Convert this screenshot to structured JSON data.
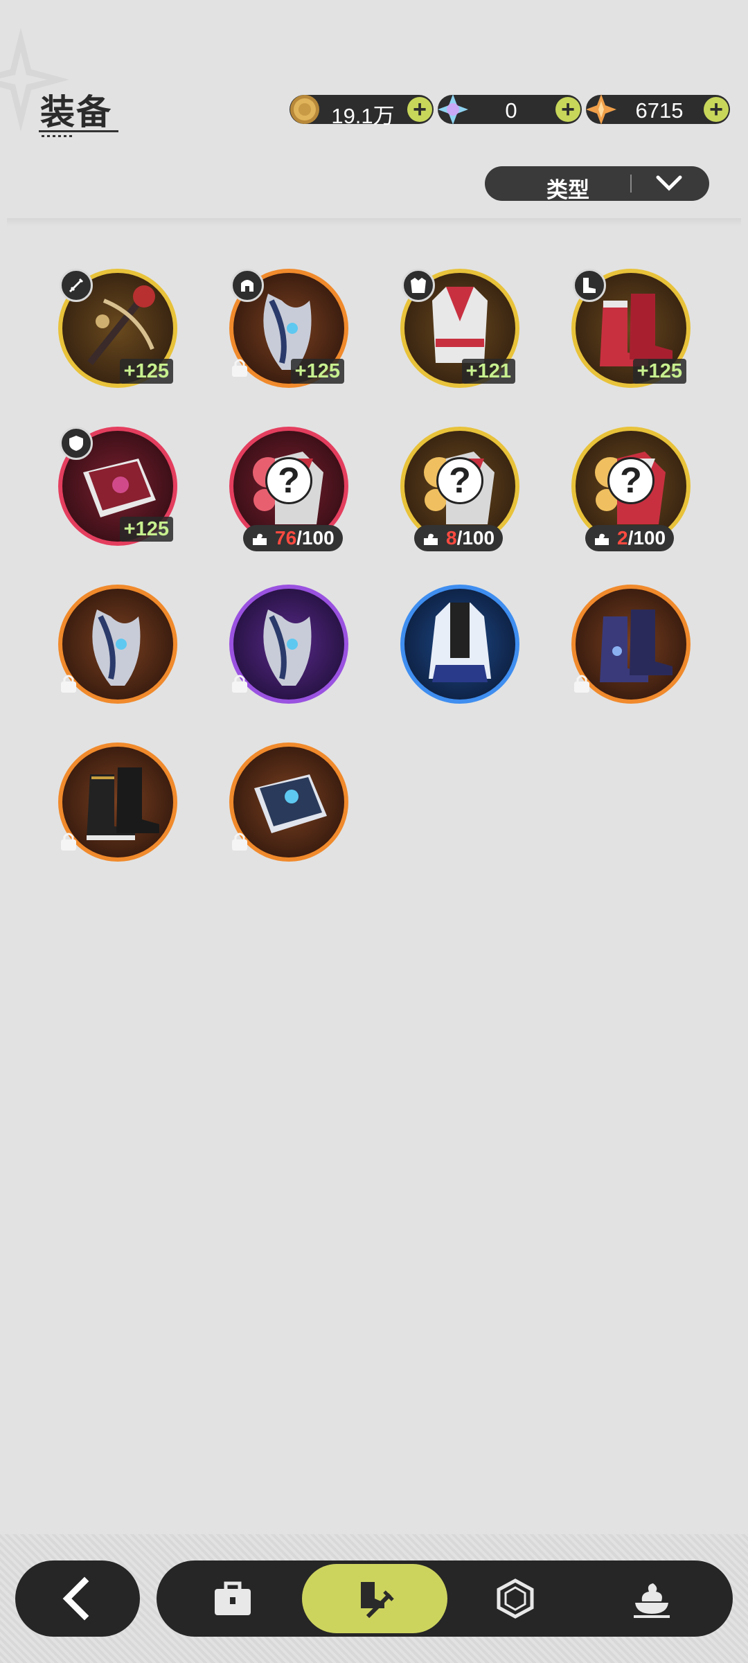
{
  "header": {
    "title": "装备"
  },
  "currencies": [
    {
      "name": "gold-coin",
      "value": "19.1万"
    },
    {
      "name": "crystal",
      "value": "0"
    },
    {
      "name": "star-gem",
      "value": "6715"
    }
  ],
  "filter": {
    "label": "类型"
  },
  "equipment": [
    {
      "name": "weapon",
      "slot": "sword",
      "rarity": "gold",
      "level": "+125"
    },
    {
      "name": "helmet",
      "slot": "helmet",
      "rarity": "orange",
      "level": "+125",
      "locked": true
    },
    {
      "name": "armor",
      "slot": "armor",
      "rarity": "gold",
      "level": "+121"
    },
    {
      "name": "boots",
      "slot": "boots",
      "rarity": "gold",
      "level": "+125"
    },
    {
      "name": "book",
      "slot": "shield",
      "rarity": "red",
      "level": "+125"
    },
    {
      "name": "unknown-armor-red",
      "rarity": "red",
      "fragments": "76",
      "fragments_total": "/100"
    },
    {
      "name": "unknown-armor-gold-1",
      "rarity": "gold",
      "fragments": "8",
      "fragments_total": "/100"
    },
    {
      "name": "unknown-armor-gold-2",
      "rarity": "gold",
      "fragments": "2",
      "fragments_total": "/100"
    },
    {
      "name": "helmet-orange",
      "rarity": "orange",
      "locked": true
    },
    {
      "name": "helmet-purple",
      "rarity": "purple",
      "locked": true
    },
    {
      "name": "robe-blue",
      "rarity": "blue"
    },
    {
      "name": "boots-dark",
      "rarity": "orange",
      "locked": true
    },
    {
      "name": "boots-black",
      "rarity": "orange",
      "locked": true
    },
    {
      "name": "tome-silver",
      "rarity": "orange",
      "locked": true
    }
  ],
  "nav": {
    "items": [
      "bag-icon",
      "equipment-icon",
      "gem-icon",
      "dessert-icon"
    ],
    "active": "equipment-icon"
  },
  "colors": {
    "gold": "#e8c23a",
    "orange": "#f08a2c",
    "red": "#e43e5e",
    "purple": "#9a52e0",
    "blue": "#3f8ef0",
    "accent": "#cdd45e"
  }
}
